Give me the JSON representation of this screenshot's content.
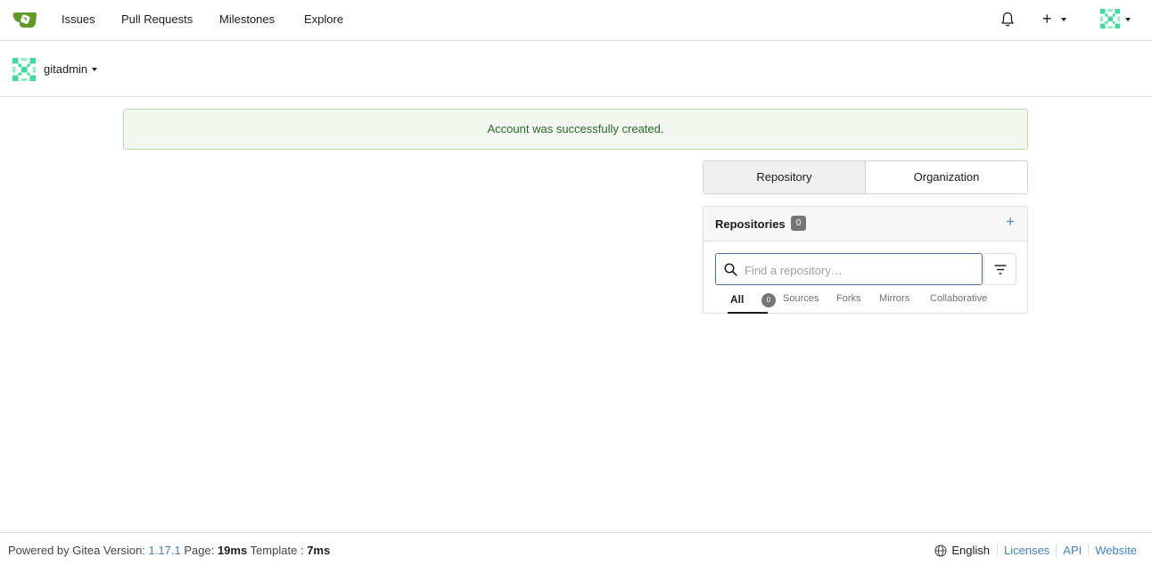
{
  "nav": {
    "items": [
      "Issues",
      "Pull Requests",
      "Milestones",
      "Explore"
    ],
    "plus_label": "+"
  },
  "context": {
    "username": "gitadmin"
  },
  "flash": {
    "message": "Account was successfully created."
  },
  "switcher": {
    "tabs": [
      "Repository",
      "Organization"
    ],
    "active": "Repository"
  },
  "repos": {
    "title": "Repositories",
    "count": "0",
    "add_label": "+",
    "search_placeholder": "Find a repository…",
    "tabs": [
      "All",
      "Sources",
      "Forks",
      "Mirrors",
      "Collaborative"
    ],
    "all_count": "0"
  },
  "footer": {
    "powered_prefix": "Powered by Gitea Version:",
    "version": "1.17.1",
    "page_label": "Page:",
    "page_time": "19ms",
    "template_label": "Template :",
    "template_time": "7ms",
    "language": "English",
    "links": [
      "Licenses",
      "API",
      "Website"
    ]
  },
  "colors": {
    "accent": "#4183c4",
    "success_text": "#2c662d",
    "success_bg": "#f2f8f0",
    "logo_green": "#609926"
  }
}
